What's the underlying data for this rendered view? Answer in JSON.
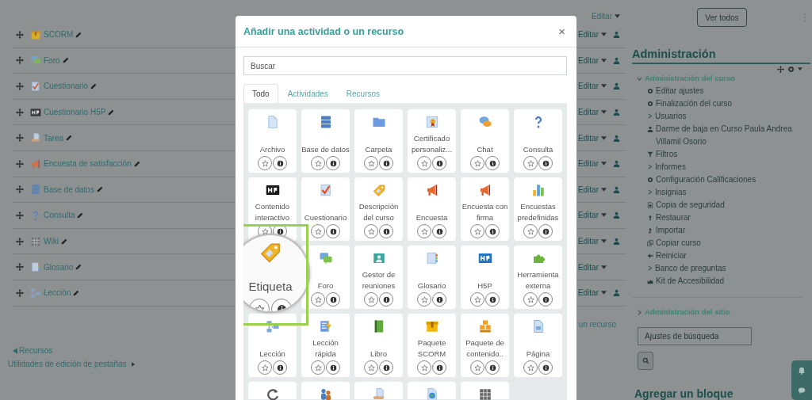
{
  "course_section": {
    "edit_label": "Editar",
    "activities": [
      {
        "name": "SCORM",
        "edit_label": "Editar",
        "role_icon": true
      },
      {
        "name": "Foro",
        "edit_label": "Editar",
        "role_icon": true
      },
      {
        "name": "Cuestionario",
        "edit_label": "Editar",
        "role_icon": true
      },
      {
        "name": "Cuestionario H5P",
        "edit_label": "Editar",
        "role_icon": true
      },
      {
        "name": "Tarea",
        "edit_label": "Editar",
        "role_icon": true
      },
      {
        "name": "Encuesta de satisfacción",
        "edit_label": "Editar",
        "role_icon": true
      },
      {
        "name": "Base de datos",
        "edit_label": "Editar",
        "role_icon": true
      },
      {
        "name": "Consulta",
        "edit_label": "Editar",
        "role_icon": true
      },
      {
        "name": "Wiki",
        "edit_label": "Editar",
        "role_icon": true
      },
      {
        "name": "Glosario",
        "edit_label": "Editar",
        "role_icon": false
      },
      {
        "name": "Lección",
        "edit_label": "Editar",
        "role_icon": true
      }
    ],
    "add_link": "un recurso"
  },
  "section_nav": {
    "previous": "Recursos",
    "utilities": "Utilidades de edición de pestañas"
  },
  "modal": {
    "title": "Añadir una actividad o un recurso",
    "close": "×",
    "search": {
      "placeholder": "Buscar"
    },
    "tabs": [
      {
        "label": "Todo",
        "selected": true
      },
      {
        "label": "Actividades",
        "selected": false
      },
      {
        "label": "Recursos",
        "selected": false
      }
    ],
    "tiles": [
      {
        "name": "Archivo",
        "highlighted": false
      },
      {
        "name": "Base de datos",
        "highlighted": false
      },
      {
        "name": "Carpeta",
        "highlighted": false
      },
      {
        "name": "Certificado personaliz...",
        "highlighted": false
      },
      {
        "name": "Chat",
        "highlighted": false
      },
      {
        "name": "Consulta",
        "highlighted": false
      },
      {
        "name": "Contenido interactivo",
        "highlighted": false
      },
      {
        "name": "Cuestionario",
        "highlighted": false
      },
      {
        "name": "Descripción del curso",
        "highlighted": false
      },
      {
        "name": "Encuesta",
        "highlighted": false
      },
      {
        "name": "Encuesta con firma",
        "highlighted": false
      },
      {
        "name": "Encuestas predefinidas",
        "highlighted": false
      },
      {
        "name": "Etiqueta",
        "highlighted": true
      },
      {
        "name": "Foro",
        "highlighted": false
      },
      {
        "name": "Gestor de reuniones",
        "highlighted": false
      },
      {
        "name": "Glosario",
        "highlighted": false
      },
      {
        "name": "H5P",
        "highlighted": false
      },
      {
        "name": "Herramienta externa",
        "highlighted": false
      },
      {
        "name": "Lección",
        "highlighted": false
      },
      {
        "name": "Lección rápida",
        "highlighted": false
      },
      {
        "name": "Libro",
        "highlighted": false
      },
      {
        "name": "Paquete SCORM",
        "highlighted": false
      },
      {
        "name": "Paquete de contenido..",
        "highlighted": false
      },
      {
        "name": "Página",
        "highlighted": false
      },
      {
        "highlighted": false
      },
      {
        "highlighted": false
      },
      {
        "highlighted": false
      },
      {
        "highlighted": false
      },
      {
        "highlighted": false
      }
    ]
  },
  "sidebar": {
    "view_all": "Ver todos",
    "admin": {
      "title": "Administración",
      "course": {
        "label": "Administración del curso",
        "expanded": true,
        "children": [
          {
            "kind": "link",
            "label": "Editar ajustes"
          },
          {
            "kind": "link",
            "label": "Finalización del curso"
          },
          {
            "kind": "branch",
            "expanded": false,
            "label": "Usuarios"
          },
          {
            "kind": "link",
            "label": "Darme de baja en Curso Paula Andrea Villamil Osorio"
          },
          {
            "kind": "link",
            "label": "Filtros"
          },
          {
            "kind": "branch",
            "expanded": false,
            "label": "Informes"
          },
          {
            "kind": "link",
            "label": "Configuración Calificaciones"
          },
          {
            "kind": "branch",
            "expanded": false,
            "label": "Insignias"
          },
          {
            "kind": "link",
            "label": "Copia de seguridad"
          },
          {
            "kind": "link",
            "label": "Restaurar"
          },
          {
            "kind": "link",
            "label": "Importar"
          },
          {
            "kind": "link",
            "label": "Copiar curso"
          },
          {
            "kind": "link",
            "label": "Reiniciar"
          },
          {
            "kind": "branch",
            "expanded": false,
            "label": "Banco de preguntas"
          },
          {
            "kind": "link",
            "label": "Kit de Accesibilidad"
          }
        ]
      },
      "site": {
        "label": "Administración del sitio",
        "expanded": false
      }
    },
    "search": {
      "placeholder": "Ajustes de búsqueda"
    },
    "add_block": "Agregar un bloque"
  }
}
